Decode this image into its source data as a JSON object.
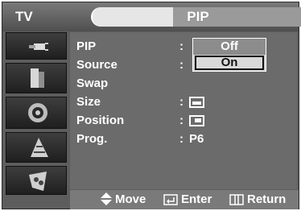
{
  "header": {
    "tv_label": "TV",
    "title": "PIP"
  },
  "sidebar": {
    "icons": [
      "connector-icon",
      "channel-icon",
      "sound-icon",
      "setup-icon",
      "input-icon"
    ]
  },
  "menu": {
    "rows": [
      {
        "label": "PIP",
        "colon": ":"
      },
      {
        "label": "Source",
        "colon": ":"
      },
      {
        "label": "Swap"
      },
      {
        "label": "Size",
        "colon": ":"
      },
      {
        "label": "Position",
        "colon": ":"
      },
      {
        "label": "Prog.",
        "colon": ":",
        "value": "P6"
      }
    ],
    "dropdown": {
      "options": [
        "Off",
        "On"
      ],
      "selected": "On"
    }
  },
  "footer": {
    "move": "Move",
    "enter": "Enter",
    "return": "Return"
  },
  "colors": {
    "background": "#5d5d5d",
    "panel": "#6b6b6b",
    "highlight": "#d9d9d9",
    "text": "#ffffff"
  }
}
